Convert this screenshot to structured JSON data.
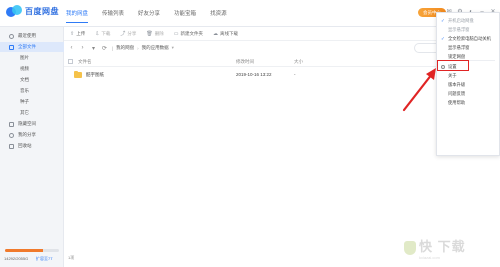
{
  "app": {
    "title": "百度网盘",
    "vip_label": "会员中心"
  },
  "nav_tabs": [
    {
      "label": "我的网盘",
      "active": true
    },
    {
      "label": "传输列表",
      "active": false
    },
    {
      "label": "好友分享",
      "active": false
    },
    {
      "label": "功能宝箱",
      "active": false
    },
    {
      "label": "找资源",
      "active": false
    }
  ],
  "window_icons": [
    "mail-icon",
    "gear-icon",
    "skin-icon",
    "minimize-icon",
    "close-icon"
  ],
  "sidebar": {
    "items": [
      {
        "label": "最近使用",
        "icon": "clock-icon",
        "active": false,
        "sub": false
      },
      {
        "label": "全部文件",
        "icon": "folder-icon",
        "active": true,
        "sub": false
      },
      {
        "label": "图片",
        "icon": "",
        "active": false,
        "sub": true
      },
      {
        "label": "视频",
        "icon": "",
        "active": false,
        "sub": true
      },
      {
        "label": "文档",
        "icon": "",
        "active": false,
        "sub": true
      },
      {
        "label": "音乐",
        "icon": "",
        "active": false,
        "sub": true
      },
      {
        "label": "种子",
        "icon": "",
        "active": false,
        "sub": true
      },
      {
        "label": "其它",
        "icon": "",
        "active": false,
        "sub": true
      },
      {
        "label": "隐藏空间",
        "icon": "lock-icon",
        "active": false,
        "sub": false
      },
      {
        "label": "我的分享",
        "icon": "share-icon",
        "active": false,
        "sub": false
      },
      {
        "label": "回收站",
        "icon": "trash-icon",
        "active": false,
        "sub": false
      }
    ],
    "storage_text": "14292/2055G",
    "storage_link": "扩容至7T",
    "storage_fraction": 0.7
  },
  "toolbar": {
    "buttons": [
      {
        "label": "上传",
        "icon": "upload-icon",
        "disabled": false
      },
      {
        "label": "下载",
        "icon": "download-icon",
        "disabled": true
      },
      {
        "label": "分享",
        "icon": "share-icon",
        "disabled": true
      },
      {
        "label": "删除",
        "icon": "trash-icon",
        "disabled": true
      },
      {
        "label": "新建文件夹",
        "icon": "new-folder-icon",
        "disabled": false
      },
      {
        "label": "离线下载",
        "icon": "cloud-download-icon",
        "disabled": false
      }
    ]
  },
  "pathbar": {
    "crumbs": [
      "我的网盘",
      "我的应用数据"
    ]
  },
  "table": {
    "headers": {
      "name": "文件名",
      "modified": "修改时间",
      "size": "大小"
    },
    "rows": [
      {
        "name": "酷宇图纸",
        "modified": "2019-10-16 13:22",
        "size": "-"
      }
    ]
  },
  "status": {
    "count": "1项"
  },
  "menu": {
    "items": [
      {
        "label": "开机启动网盘",
        "checked": true,
        "gray": true
      },
      {
        "label": "显示悬浮窗",
        "checked": false,
        "gray": true
      },
      {
        "label": "全文检索电脑自动关机",
        "checked": true,
        "gray": false
      },
      {
        "label": "显示悬浮窗",
        "checked": false,
        "gray": false
      },
      {
        "label": "锁定网盘",
        "checked": false,
        "gray": false
      },
      {
        "label": "设置",
        "checked": false,
        "gray": false,
        "highlighted": true
      },
      {
        "label": "关于",
        "checked": false,
        "gray": false
      },
      {
        "label": "版本升级",
        "checked": false,
        "gray": false
      },
      {
        "label": "问题反馈",
        "checked": false,
        "gray": false
      },
      {
        "label": "使用帮助",
        "checked": false,
        "gray": false
      }
    ]
  },
  "watermark": {
    "text": "快 下载",
    "sub": "kxiazai.com"
  },
  "colors": {
    "accent": "#2f7bf6",
    "vip": "#f28a1e",
    "highlight": "#e02424",
    "folder": "#f5c24a"
  }
}
